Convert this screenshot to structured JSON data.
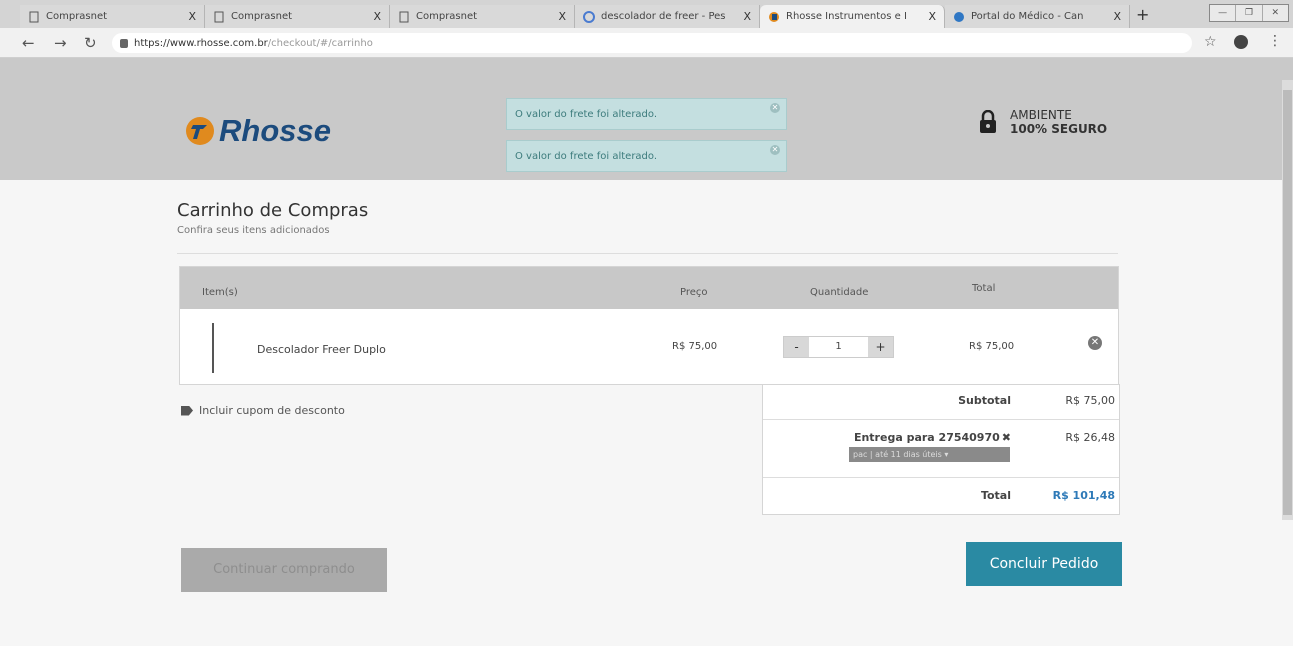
{
  "browser": {
    "tabs": [
      {
        "label": "Comprasnet",
        "icon": "doc-icon"
      },
      {
        "label": "Comprasnet",
        "icon": "doc-icon"
      },
      {
        "label": "Comprasnet",
        "icon": "doc-icon"
      },
      {
        "label": "descolador de freer - Pes",
        "icon": "google-icon"
      },
      {
        "label": "Rhosse Instrumentos e I",
        "icon": "rhosse-icon",
        "active": true
      },
      {
        "label": "Portal do Médico - Can",
        "icon": "portal-icon"
      }
    ],
    "tab_close": "X",
    "new_tab": "+",
    "url_host": "https://www.rhosse.com.br",
    "url_path": "/checkout/#/carrinho"
  },
  "header": {
    "logo_text": "Rhosse",
    "alerts": [
      "O valor do frete foi alterado.",
      "O valor do frete foi alterado."
    ],
    "secure_line1": "AMBIENTE",
    "secure_line2": "100% SEGURO"
  },
  "cart": {
    "title": "Carrinho de Compras",
    "subtitle": "Confira seus itens adicionados",
    "columns": {
      "item": "Item(s)",
      "price": "Preço",
      "quantity": "Quantidade",
      "total": "Total"
    },
    "items": [
      {
        "name": "Descolador Freer Duplo",
        "price": "R$ 75,00",
        "quantity": "1",
        "total": "R$ 75,00"
      }
    ],
    "qty_minus": "-",
    "qty_plus": "+"
  },
  "coupon": {
    "label": "Incluir cupom de desconto"
  },
  "summary": {
    "subtotal_label": "Subtotal",
    "subtotal_value": "R$ 75,00",
    "shipping_label": "Entrega para 27540970",
    "shipping_remove": "✖",
    "shipping_value": "R$ 26,48",
    "shipping_option": "pac | até 11 dias úteis",
    "total_label": "Total",
    "total_value": "R$ 101,48"
  },
  "actions": {
    "continue_label": "Continuar comprando",
    "finish_label": "Concluir Pedido"
  },
  "colors": {
    "brand_blue": "#1c4b7d",
    "accent_teal": "#2a8aa3",
    "total_blue": "#2e7ab8"
  }
}
